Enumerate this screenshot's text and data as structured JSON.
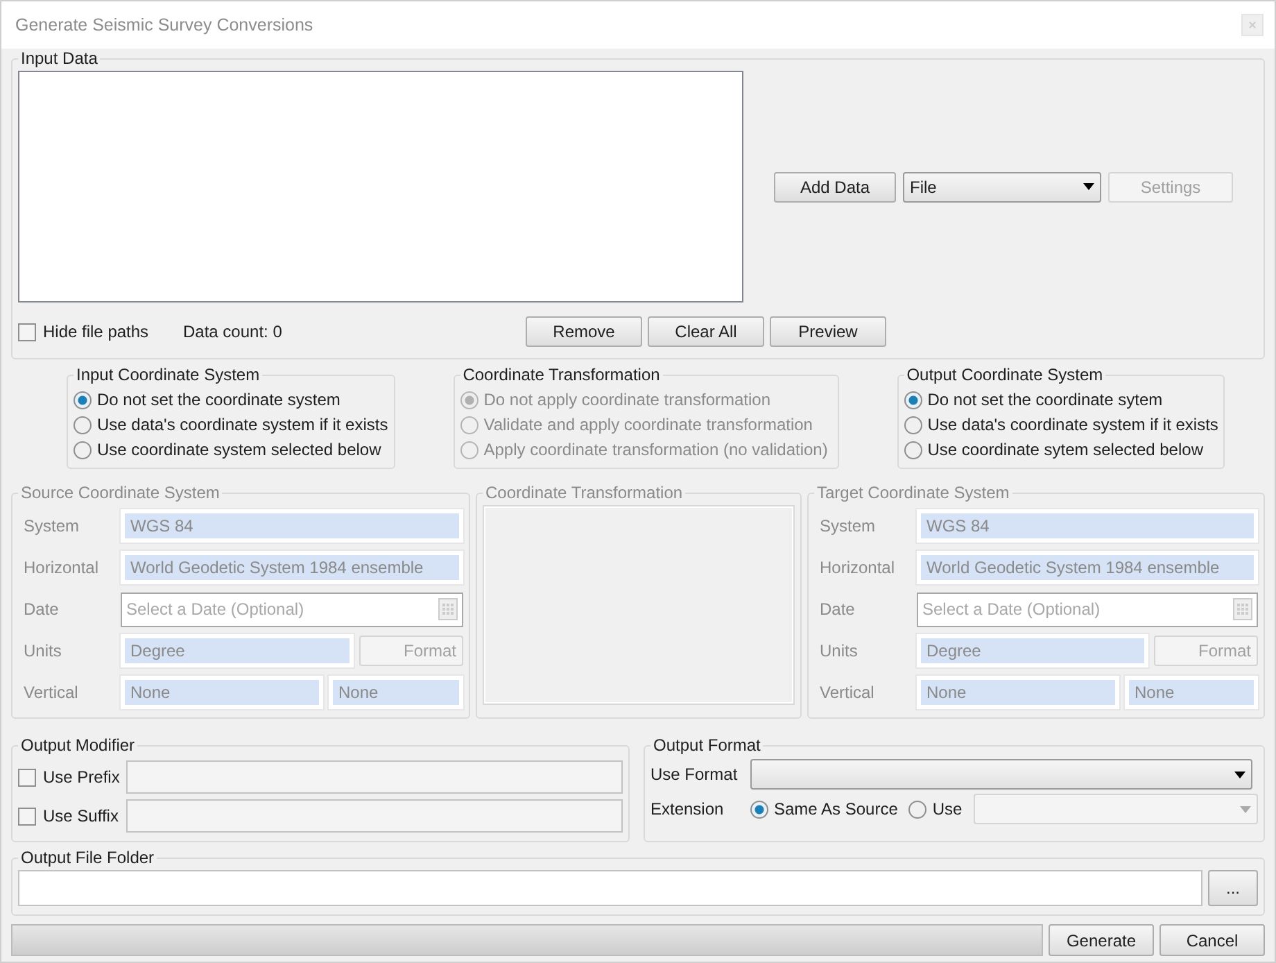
{
  "window": {
    "title": "Generate Seismic Survey Conversions"
  },
  "input_data": {
    "title": "Input Data",
    "hide_file_paths": {
      "label": "Hide file paths",
      "checked": false
    },
    "data_count": "Data count: 0",
    "list_buttons": [
      {
        "label": "Remove",
        "disabled": false
      },
      {
        "label": "Clear All",
        "disabled": false
      },
      {
        "label": "Preview",
        "disabled": false
      }
    ],
    "add_data": {
      "label": "Add Data",
      "disabled": false
    },
    "source_type": "File",
    "settings": {
      "label": "Settings",
      "disabled": true
    }
  },
  "radio_groups": [
    {
      "title": "Input Coordinate System",
      "disabled": false,
      "options": [
        {
          "label": "Do not set the coordinate system",
          "selected": true
        },
        {
          "label": "Use data's coordinate system if it exists",
          "selected": false
        },
        {
          "label": "Use coordinate system selected below",
          "selected": false
        }
      ]
    },
    {
      "title": "Coordinate Transformation",
      "disabled": true,
      "options": [
        {
          "label": "Do not apply coordinate transformation",
          "selected": true
        },
        {
          "label": "Validate and apply coordinate transformation",
          "selected": false
        },
        {
          "label": "Apply coordinate transformation (no validation)",
          "selected": false
        }
      ]
    },
    {
      "title": "Output Coordinate System",
      "disabled": false,
      "options": [
        {
          "label": "Do not set the coordinate sytem",
          "selected": true
        },
        {
          "label": "Use data's coordinate system if it exists",
          "selected": false
        },
        {
          "label": "Use coordinate sytem selected below",
          "selected": false
        }
      ]
    }
  ],
  "source_system": {
    "title": "Source Coordinate System",
    "disabled": true,
    "rows": [
      {
        "kind": "text",
        "label": "System",
        "value": "WGS 84"
      },
      {
        "kind": "text",
        "label": "Horizontal",
        "value": "World Geodetic System 1984 ensemble"
      },
      {
        "kind": "date",
        "label": "Date",
        "placeholder": "Select a Date (Optional)"
      },
      {
        "kind": "units",
        "label": "Units",
        "value": "Degree",
        "button": "Format"
      },
      {
        "kind": "pair",
        "label": "Vertical",
        "value": "None",
        "value_2": "None"
      }
    ]
  },
  "transformation": {
    "title": "Coordinate Transformation",
    "disabled": true
  },
  "target_system": {
    "title": "Target Coordinate System",
    "disabled": true,
    "rows": [
      {
        "kind": "text",
        "label": "System",
        "value": "WGS 84"
      },
      {
        "kind": "text",
        "label": "Horizontal",
        "value": "World Geodetic System 1984 ensemble"
      },
      {
        "kind": "date",
        "label": "Date",
        "placeholder": "Select a Date (Optional)"
      },
      {
        "kind": "units",
        "label": "Units",
        "value": "Degree",
        "button": "Format"
      },
      {
        "kind": "pair",
        "label": "Vertical",
        "value": "None",
        "value_2": "None"
      }
    ]
  },
  "output_modifier": {
    "title": "Output Modifier",
    "options": [
      {
        "label": "Use Prefix",
        "checked": false
      },
      {
        "label": "Use Suffix",
        "checked": false
      }
    ]
  },
  "output_format": {
    "title": "Output Format",
    "format_label": "Use Format",
    "extension_label": "Extension",
    "extension_options": [
      {
        "label": "Same As Source",
        "selected": true
      },
      {
        "label": "Use",
        "selected": false
      }
    ]
  },
  "output_folder": {
    "title": "Output File Folder",
    "browse": "..."
  },
  "footer": {
    "progress": {
      "level": 0
    },
    "buttons": [
      {
        "label": "Generate"
      },
      {
        "label": "Cancel"
      }
    ]
  }
}
